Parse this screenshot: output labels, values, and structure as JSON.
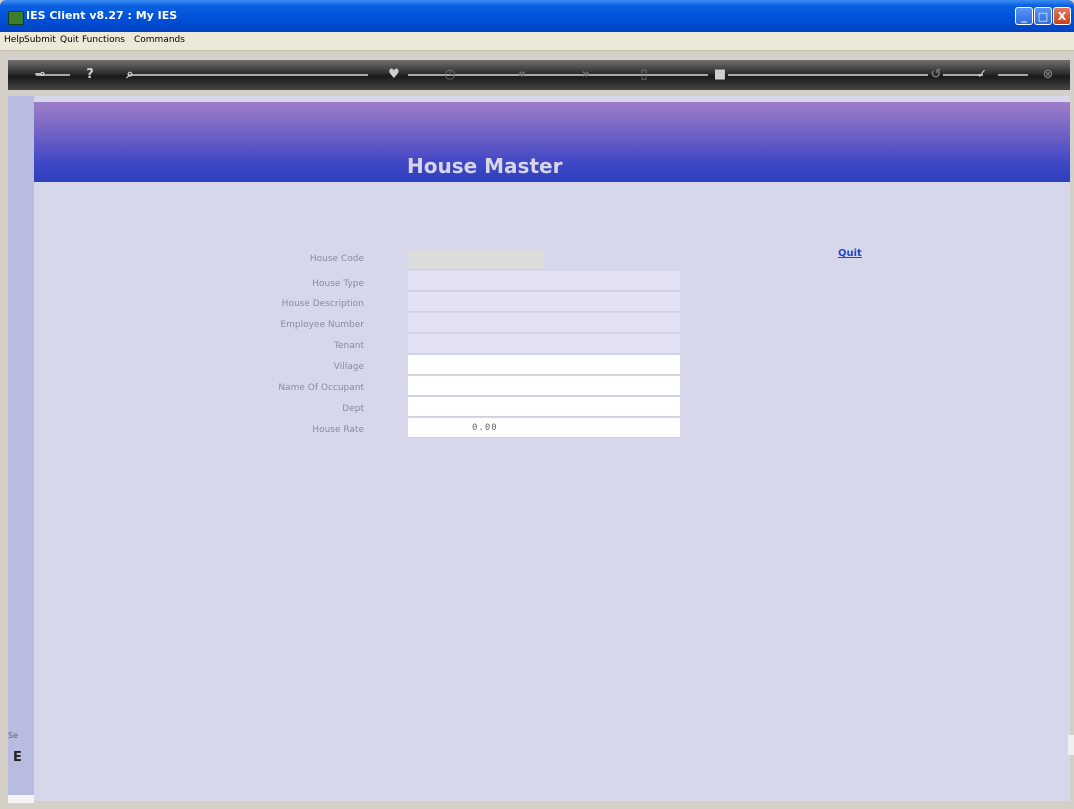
{
  "window": {
    "title": "IES Client v8.27 : My IES",
    "controls": {
      "minimize": "_",
      "maximize": "□",
      "close": "X"
    }
  },
  "menu": [
    "Help",
    "Submit",
    "Quit",
    "Functions",
    "Commands"
  ],
  "toolbar": {
    "icons": [
      "key-icon",
      "help-icon",
      "search-icon",
      "heart-icon",
      "clock-icon",
      "rewind-icon",
      "forward-icon",
      "document-icon",
      "stop-icon",
      "undo-icon",
      "check-icon",
      "close-icon"
    ]
  },
  "sidebar": {
    "section_label": "Se",
    "icon_glyph": "E"
  },
  "page": {
    "title": "House Master",
    "quit_link": "Quit"
  },
  "form": {
    "fields": [
      {
        "label": "House Code",
        "value": ""
      },
      {
        "label": "House Type",
        "value": ""
      },
      {
        "label": "House Description",
        "value": ""
      },
      {
        "label": "Employee Number",
        "value": ""
      },
      {
        "label": "Tenant",
        "value": ""
      },
      {
        "label": "Village",
        "value": ""
      },
      {
        "label": "Name Of Occupant",
        "value": ""
      },
      {
        "label": "Dept",
        "value": ""
      },
      {
        "label": "House Rate",
        "value": "0.00"
      }
    ]
  }
}
